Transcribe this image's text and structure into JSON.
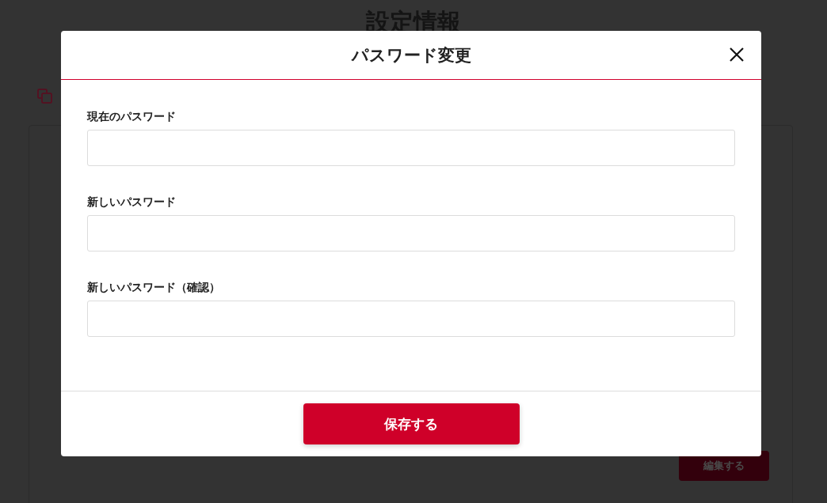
{
  "page": {
    "title": "設定情報",
    "edit_button": "編集する"
  },
  "dialog": {
    "title": "パスワード変更",
    "fields": [
      {
        "label": "現在のパスワード"
      },
      {
        "label": "新しいパスワード"
      },
      {
        "label": "新しいパスワード（確認）"
      }
    ],
    "save_button": "保存する"
  }
}
